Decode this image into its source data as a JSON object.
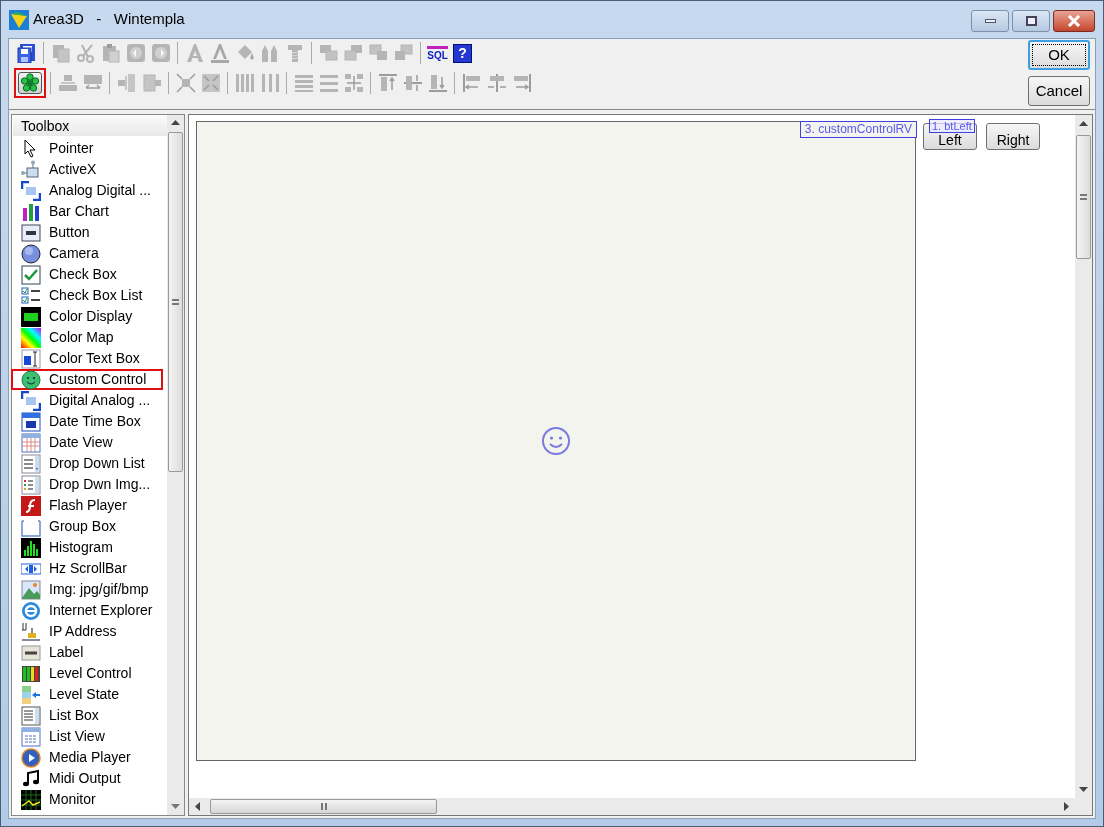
{
  "window": {
    "title": "Area3D   -   Wintempla"
  },
  "toolbar": {
    "rows": [
      [
        [
          {
            "disabled": false,
            "selected": false
          }
        ],
        [
          {
            "disabled": true,
            "selected": false
          },
          {
            "disabled": true,
            "selected": false
          },
          {
            "disabled": true,
            "selected": false
          },
          {
            "disabled": true,
            "selected": false
          },
          {
            "disabled": true,
            "selected": false
          }
        ],
        [
          {
            "disabled": true,
            "selected": false
          },
          {
            "disabled": true,
            "selected": false
          },
          {
            "disabled": true,
            "selected": false
          },
          {
            "disabled": true,
            "selected": false
          },
          {
            "disabled": true,
            "selected": false
          }
        ],
        [
          {
            "disabled": true,
            "selected": false
          },
          {
            "disabled": true,
            "selected": false
          },
          {
            "disabled": true,
            "selected": false
          },
          {
            "disabled": true,
            "selected": false
          }
        ],
        [
          {
            "disabled": false,
            "selected": false,
            "label": "SQL"
          },
          {
            "disabled": false,
            "selected": false,
            "label": "?"
          }
        ]
      ],
      [
        [
          {
            "disabled": false,
            "selected": true
          }
        ],
        [
          {
            "disabled": true,
            "selected": false
          },
          {
            "disabled": true,
            "selected": false
          }
        ],
        [
          {
            "disabled": true,
            "selected": false
          },
          {
            "disabled": true,
            "selected": false
          }
        ],
        [
          {
            "disabled": true,
            "selected": false
          },
          {
            "disabled": true,
            "selected": false
          }
        ],
        [
          {
            "disabled": true,
            "selected": false
          },
          {
            "disabled": true,
            "selected": false
          }
        ],
        [
          {
            "disabled": true,
            "selected": false
          },
          {
            "disabled": true,
            "selected": false
          },
          {
            "disabled": true,
            "selected": false
          }
        ],
        [
          {
            "disabled": true,
            "selected": false
          },
          {
            "disabled": true,
            "selected": false
          },
          {
            "disabled": true,
            "selected": false
          }
        ],
        [
          {
            "disabled": true,
            "selected": false
          },
          {
            "disabled": true,
            "selected": false
          },
          {
            "disabled": true,
            "selected": false
          }
        ]
      ]
    ]
  },
  "dialog_buttons": [
    {
      "label": "OK",
      "default": true
    },
    {
      "label": "Cancel",
      "default": false
    }
  ],
  "toolbox": {
    "title": "Toolbox",
    "items": [
      {
        "label": "Pointer",
        "selected": false
      },
      {
        "label": "ActiveX",
        "selected": false
      },
      {
        "label": "Analog Digital ...",
        "selected": false
      },
      {
        "label": "Bar Chart",
        "selected": false
      },
      {
        "label": "Button",
        "selected": false
      },
      {
        "label": "Camera",
        "selected": false
      },
      {
        "label": "Check Box",
        "selected": false
      },
      {
        "label": "Check Box List",
        "selected": false
      },
      {
        "label": "Color Display",
        "selected": false
      },
      {
        "label": "Color Map",
        "selected": false
      },
      {
        "label": "Color Text Box",
        "selected": false
      },
      {
        "label": "Custom Control",
        "selected": true
      },
      {
        "label": "Digital Analog ...",
        "selected": false
      },
      {
        "label": "Date Time Box",
        "selected": false
      },
      {
        "label": "Date View",
        "selected": false
      },
      {
        "label": "Drop Down List",
        "selected": false
      },
      {
        "label": "Drop Dwn Img...",
        "selected": false
      },
      {
        "label": "Flash Player",
        "selected": false
      },
      {
        "label": "Group Box",
        "selected": false
      },
      {
        "label": "Histogram",
        "selected": false
      },
      {
        "label": "Hz ScrollBar",
        "selected": false
      },
      {
        "label": "Img: jpg/gif/bmp",
        "selected": false
      },
      {
        "label": "Internet Explorer",
        "selected": false
      },
      {
        "label": "IP Address",
        "selected": false
      },
      {
        "label": "Label",
        "selected": false
      },
      {
        "label": "Level Control",
        "selected": false
      },
      {
        "label": "Level State",
        "selected": false
      },
      {
        "label": "List Box",
        "selected": false
      },
      {
        "label": "List View",
        "selected": false
      },
      {
        "label": "Media Player",
        "selected": false
      },
      {
        "label": "Midi Output",
        "selected": false
      },
      {
        "label": "Monitor",
        "selected": false
      }
    ]
  },
  "design_surface": {
    "controls": [
      {
        "kind": "custom_control",
        "tag": "3. customControlRV"
      },
      {
        "kind": "button",
        "label": "Left",
        "tag": "1. btLeft"
      },
      {
        "kind": "button",
        "label": "Right"
      }
    ]
  }
}
